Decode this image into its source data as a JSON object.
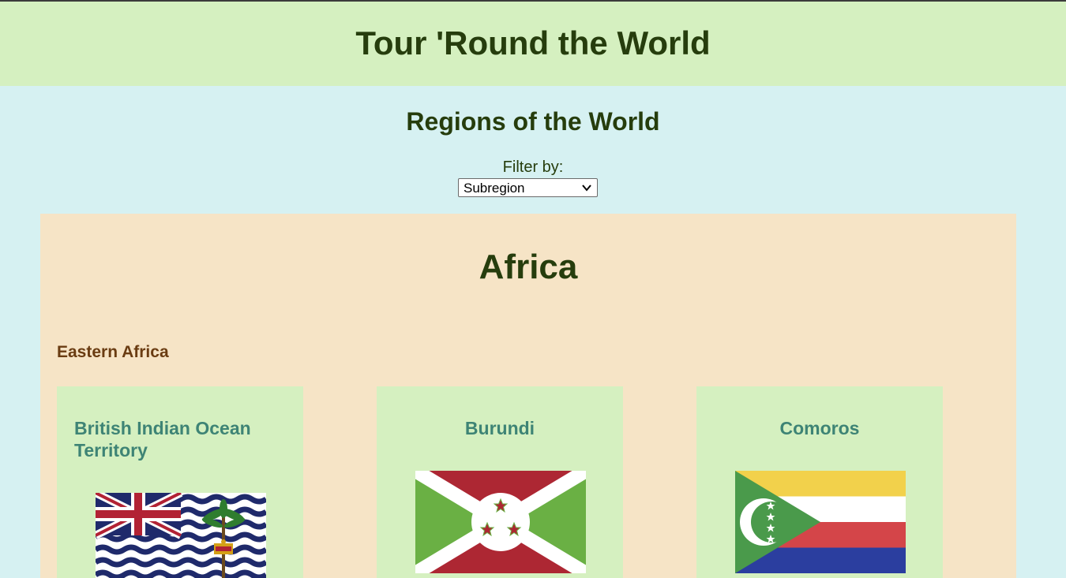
{
  "header": {
    "title": "Tour 'Round the World"
  },
  "main": {
    "title": "Regions of the World",
    "filter": {
      "label": "Filter by:",
      "selected": "Subregion"
    }
  },
  "continent": {
    "name": "Africa",
    "subregion": "Eastern Africa",
    "countries": [
      {
        "name": "British Indian Ocean Territory",
        "flag_icon": "biot-flag"
      },
      {
        "name": "Burundi",
        "flag_icon": "burundi-flag"
      },
      {
        "name": "Comoros",
        "flag_icon": "comoros-flag"
      }
    ]
  },
  "colors": {
    "header_bg": "#d5f0c0",
    "page_bg": "#d6f1f2",
    "panel_bg": "#f6e4c6",
    "card_bg": "#d5f0c0",
    "title_text": "#263d0d",
    "subregion_text": "#6a3c12",
    "country_text": "#3e8475"
  }
}
